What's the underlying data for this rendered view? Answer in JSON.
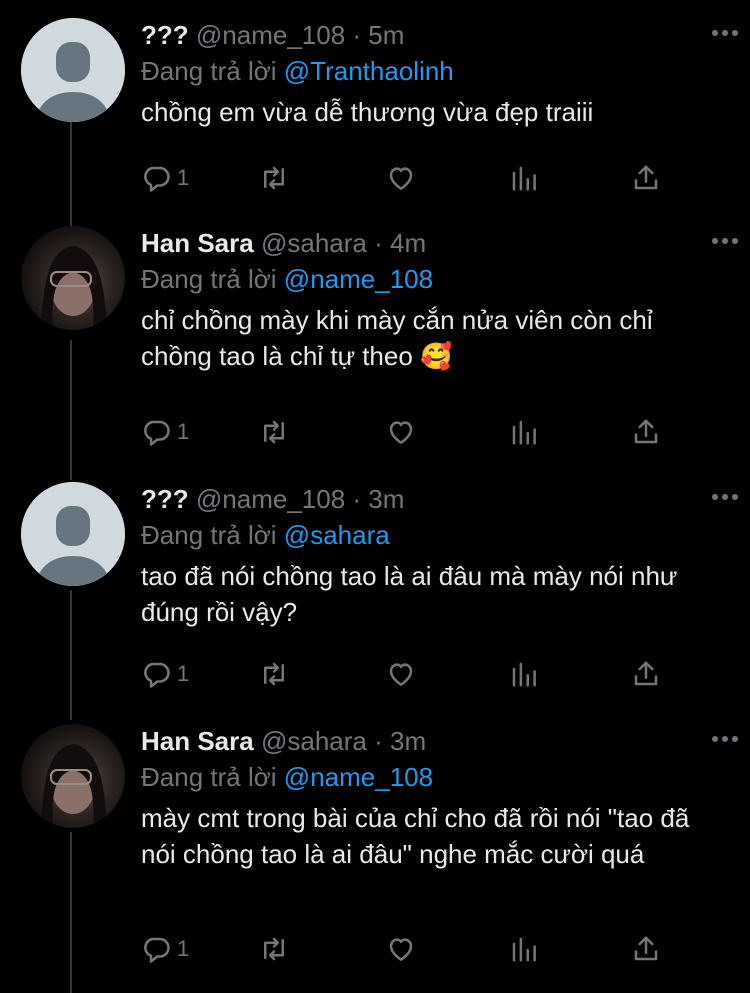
{
  "tweets": [
    {
      "name": "???",
      "handle": "@name_108",
      "time": "· 5m",
      "replying_prefix": "Đang trả lời",
      "replying_to": "@Tranthaolinh",
      "text": "chồng em vừa dễ thương vừa đẹp traiii",
      "reply_count": "1",
      "avatar": "default"
    },
    {
      "name": "Han Sara",
      "handle": "@sahara",
      "time": "· 4m",
      "replying_prefix": "Đang trả lời",
      "replying_to": "@name_108",
      "text": "chỉ chồng mày khi mày cắn nửa viên còn chỉ chồng tao là chỉ tự theo 🥰",
      "reply_count": "1",
      "avatar": "photo"
    },
    {
      "name": "???",
      "handle": "@name_108",
      "time": "· 3m",
      "replying_prefix": "Đang trả lời",
      "replying_to": "@sahara",
      "text": "tao đã nói chồng tao là ai đâu mà mày nói như đúng rồi vậy?",
      "reply_count": "1",
      "avatar": "default"
    },
    {
      "name": "Han Sara",
      "handle": "@sahara",
      "time": "· 3m",
      "replying_prefix": "Đang trả lời",
      "replying_to": "@name_108",
      "text": "mày cmt trong bài của chỉ cho đã rồi nói \"tao đã nói chồng tao là ai đâu\" nghe mắc cười quá",
      "reply_count": "1",
      "avatar": "photo"
    }
  ],
  "icons": {
    "reply": "reply-icon",
    "retweet": "retweet-icon",
    "like": "heart-icon",
    "analytics": "analytics-icon",
    "share": "share-icon",
    "more": "more-icon"
  },
  "colors": {
    "background": "#000000",
    "text": "#e7e9ea",
    "muted": "#71767b",
    "link": "#1d9bf0",
    "thread_line": "#333639"
  }
}
